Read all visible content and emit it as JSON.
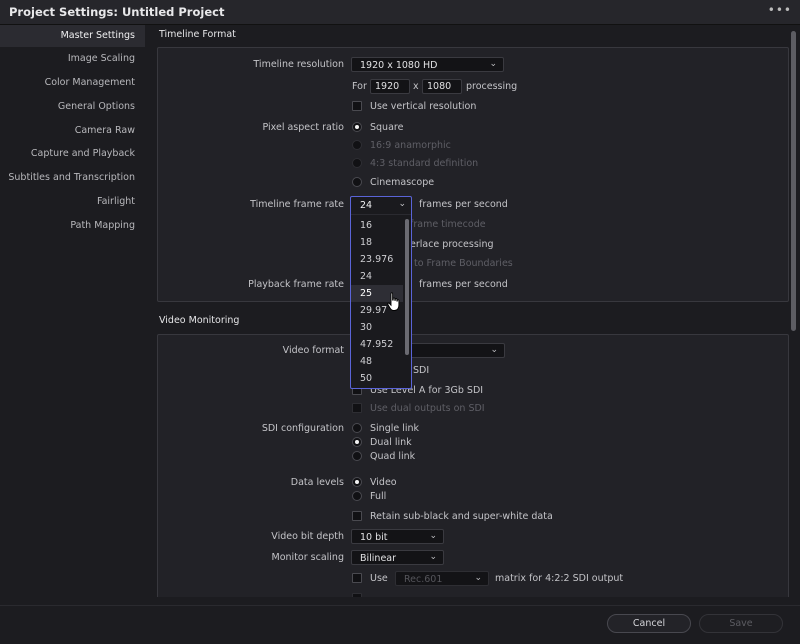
{
  "window": {
    "title": "Project Settings:  Untitled Project",
    "menu_icon": "ellipsis-icon"
  },
  "sidebar": {
    "items": [
      {
        "label": "Master Settings",
        "active": true
      },
      {
        "label": "Image Scaling"
      },
      {
        "label": "Color Management"
      },
      {
        "label": "General Options"
      },
      {
        "label": "Camera Raw"
      },
      {
        "label": "Capture and Playback"
      },
      {
        "label": "Subtitles and Transcription"
      },
      {
        "label": "Fairlight"
      },
      {
        "label": "Path Mapping"
      }
    ]
  },
  "timeline_format": {
    "section_title": "Timeline Format",
    "resolution_label": "Timeline resolution",
    "resolution_value": "1920 x 1080 HD",
    "for_label": "For",
    "width_value": "1920",
    "x_label": "x",
    "height_value": "1080",
    "processing_label": "processing",
    "vertical_label": "Use vertical resolution",
    "par_label": "Pixel aspect ratio",
    "par_options": [
      "Square",
      "16:9 anamorphic",
      "4:3 standard definition",
      "Cinemascope"
    ],
    "par_selected": "Square",
    "frame_rate_label": "Timeline frame rate",
    "frame_rate_value": "24",
    "fps_label": "frames per second",
    "drop_frame_label": "Use drop frame timecode",
    "drop_frame_visible": "frame timecode",
    "interlace_label": "Enable interlace processing",
    "interlace_visible": "erlace processing",
    "boundaries_label": "Snap to Frame Boundaries",
    "boundaries_visible": "to Frame Boundaries",
    "playback_label": "Playback frame rate",
    "playback_fps_label": "frames per second"
  },
  "frame_rate_dropdown": {
    "current": "24",
    "options": [
      "16",
      "18",
      "23.976",
      "24",
      "25",
      "29.97",
      "30",
      "47.952",
      "48",
      "50"
    ],
    "highlighted": "25"
  },
  "video_monitoring": {
    "section_title": "Video Monitoring",
    "format_label": "Video format",
    "sdi_visible": "SDI",
    "level_a_label": "Use Level A for 3Gb SDI",
    "dual_outputs_label": "Use dual outputs on SDI",
    "sdi_config_label": "SDI configuration",
    "sdi_options": [
      "Single link",
      "Dual link",
      "Quad link"
    ],
    "sdi_selected": "Dual link",
    "data_levels_label": "Data levels",
    "data_levels_options": [
      "Video",
      "Full"
    ],
    "data_levels_selected": "Video",
    "retain_label": "Retain sub-black and super-white data",
    "bit_depth_label": "Video bit depth",
    "bit_depth_value": "10 bit",
    "monitor_scaling_label": "Monitor scaling",
    "monitor_scaling_value": "Bilinear",
    "use_label": "Use",
    "matrix_value": "Rec.601",
    "matrix_label": "matrix for 4:2:2 SDI output"
  },
  "footer": {
    "cancel_label": "Cancel",
    "save_label": "Save"
  }
}
